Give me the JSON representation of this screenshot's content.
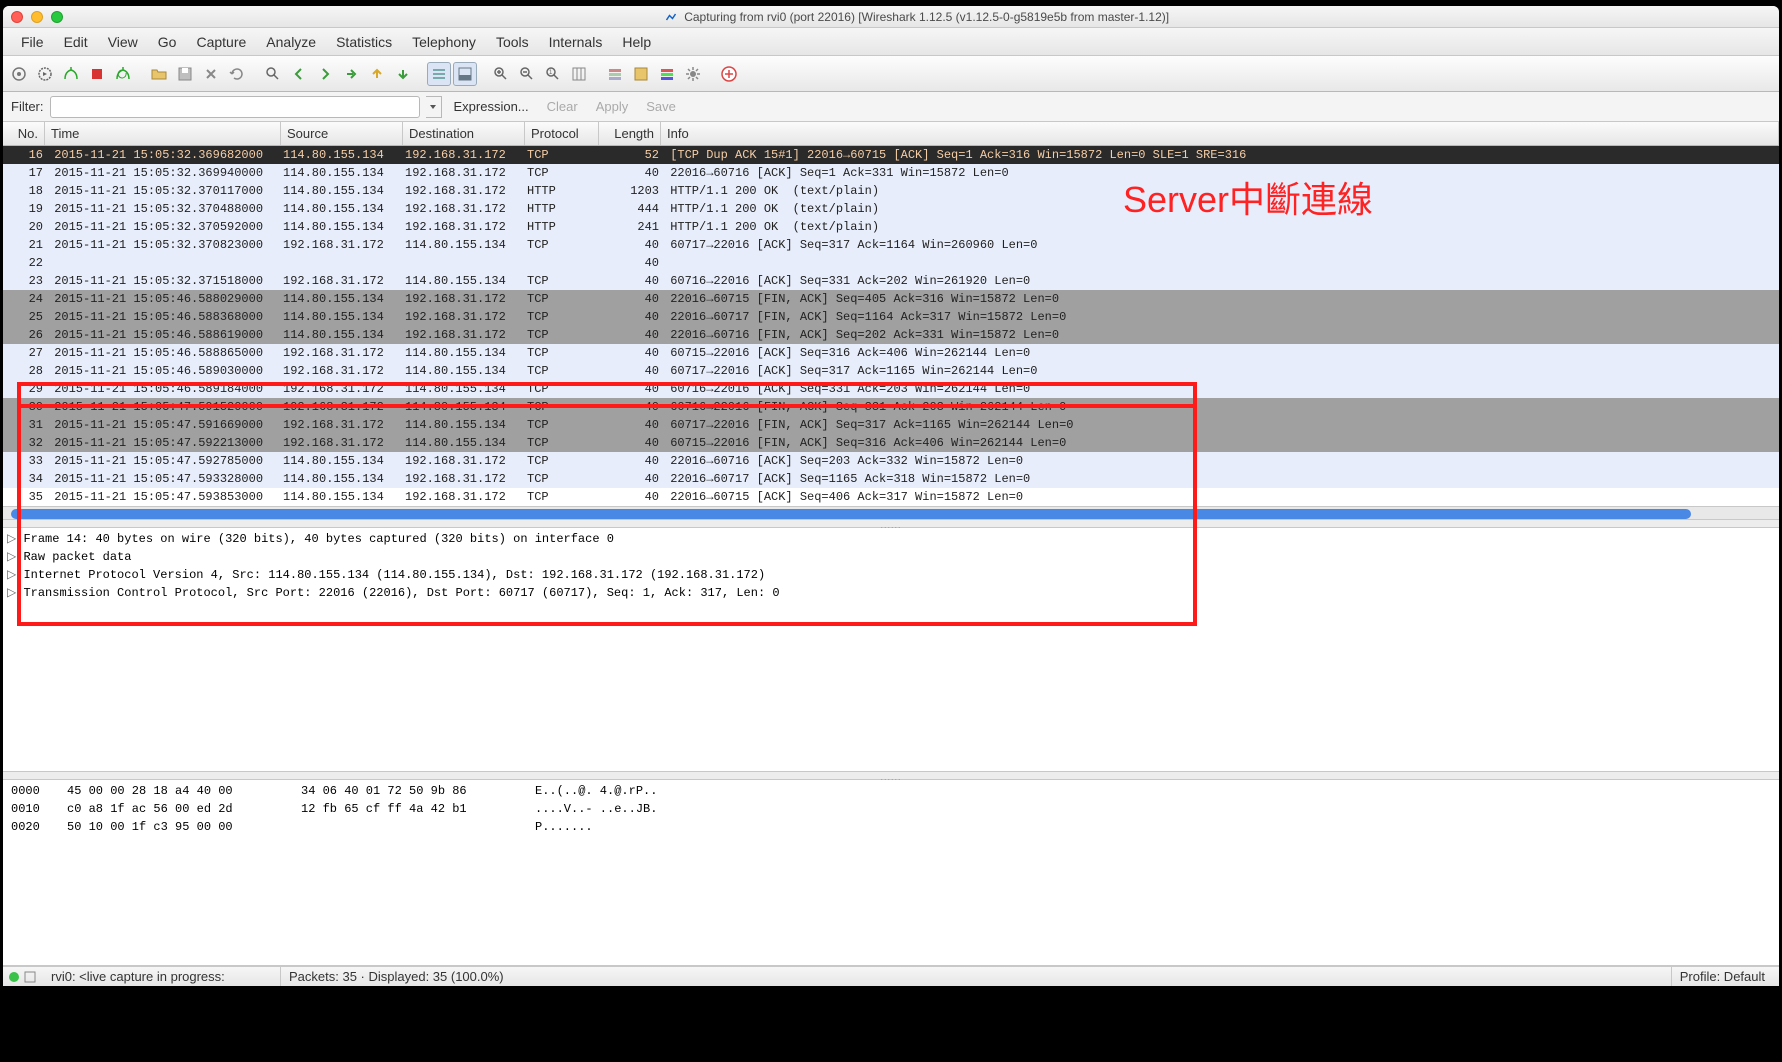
{
  "title": "Capturing from rvi0 (port 22016)   [Wireshark 1.12.5  (v1.12.5-0-g5819e5b from master-1.12)]",
  "menu": [
    "File",
    "Edit",
    "View",
    "Go",
    "Capture",
    "Analyze",
    "Statistics",
    "Telephony",
    "Tools",
    "Internals",
    "Help"
  ],
  "filter": {
    "label": "Filter:",
    "value": "",
    "expression": "Expression...",
    "clear": "Clear",
    "apply": "Apply",
    "save": "Save"
  },
  "columns": [
    "No.",
    "Time",
    "Source",
    "Destination",
    "Protocol",
    "Length",
    "Info"
  ],
  "packets": [
    {
      "no": 16,
      "time": "2015-11-21 15:05:32.369682000",
      "src": "114.80.155.134",
      "dst": "192.168.31.172",
      "proto": "TCP",
      "len": 52,
      "info": "[TCP Dup ACK 15#1] 22016→60715 [ACK] Seq=1 Ack=316 Win=15872 Len=0 SLE=1 SRE=316",
      "bg": "dark"
    },
    {
      "no": 17,
      "time": "2015-11-21 15:05:32.369940000",
      "src": "114.80.155.134",
      "dst": "192.168.31.172",
      "proto": "TCP",
      "len": 40,
      "info": "22016→60716 [ACK] Seq=1 Ack=331 Win=15872 Len=0",
      "bg": "light"
    },
    {
      "no": 18,
      "time": "2015-11-21 15:05:32.370117000",
      "src": "114.80.155.134",
      "dst": "192.168.31.172",
      "proto": "HTTP",
      "len": 1203,
      "info": "HTTP/1.1 200 OK  (text/plain)",
      "bg": "light"
    },
    {
      "no": 19,
      "time": "2015-11-21 15:05:32.370488000",
      "src": "114.80.155.134",
      "dst": "192.168.31.172",
      "proto": "HTTP",
      "len": 444,
      "info": "HTTP/1.1 200 OK  (text/plain)",
      "bg": "light"
    },
    {
      "no": 20,
      "time": "2015-11-21 15:05:32.370592000",
      "src": "114.80.155.134",
      "dst": "192.168.31.172",
      "proto": "HTTP",
      "len": 241,
      "info": "HTTP/1.1 200 OK  (text/plain)",
      "bg": "light"
    },
    {
      "no": 21,
      "time": "2015-11-21 15:05:32.370823000",
      "src": "192.168.31.172",
      "dst": "114.80.155.134",
      "proto": "TCP",
      "len": 40,
      "info": "60717→22016 [ACK] Seq=317 Ack=1164 Win=260960 Len=0",
      "bg": "light"
    },
    {
      "no": 22,
      "time": "",
      "src": "",
      "dst": "",
      "proto": "",
      "len": 40,
      "info": "",
      "bg": "light"
    },
    {
      "no": 23,
      "time": "2015-11-21 15:05:32.371518000",
      "src": "192.168.31.172",
      "dst": "114.80.155.134",
      "proto": "TCP",
      "len": 40,
      "info": "60716→22016 [ACK] Seq=331 Ack=202 Win=261920 Len=0",
      "bg": "light"
    },
    {
      "no": 24,
      "time": "2015-11-21 15:05:46.588029000",
      "src": "114.80.155.134",
      "dst": "192.168.31.172",
      "proto": "TCP",
      "len": 40,
      "info": "22016→60715 [FIN, ACK] Seq=405 Ack=316 Win=15872 Len=0",
      "bg": "gray"
    },
    {
      "no": 25,
      "time": "2015-11-21 15:05:46.588368000",
      "src": "114.80.155.134",
      "dst": "192.168.31.172",
      "proto": "TCP",
      "len": 40,
      "info": "22016→60717 [FIN, ACK] Seq=1164 Ack=317 Win=15872 Len=0",
      "bg": "gray"
    },
    {
      "no": 26,
      "time": "2015-11-21 15:05:46.588619000",
      "src": "114.80.155.134",
      "dst": "192.168.31.172",
      "proto": "TCP",
      "len": 40,
      "info": "22016→60716 [FIN, ACK] Seq=202 Ack=331 Win=15872 Len=0",
      "bg": "gray"
    },
    {
      "no": 27,
      "time": "2015-11-21 15:05:46.588865000",
      "src": "192.168.31.172",
      "dst": "114.80.155.134",
      "proto": "TCP",
      "len": 40,
      "info": "60715→22016 [ACK] Seq=316 Ack=406 Win=262144 Len=0",
      "bg": "light"
    },
    {
      "no": 28,
      "time": "2015-11-21 15:05:46.589030000",
      "src": "192.168.31.172",
      "dst": "114.80.155.134",
      "proto": "TCP",
      "len": 40,
      "info": "60717→22016 [ACK] Seq=317 Ack=1165 Win=262144 Len=0",
      "bg": "light"
    },
    {
      "no": 29,
      "time": "2015-11-21 15:05:46.589184000",
      "src": "192.168.31.172",
      "dst": "114.80.155.134",
      "proto": "TCP",
      "len": 40,
      "info": "60716→22016 [ACK] Seq=331 Ack=203 Win=262144 Len=0",
      "bg": "light"
    },
    {
      "no": 30,
      "time": "2015-11-21 15:05:47.591520000",
      "src": "192.168.31.172",
      "dst": "114.80.155.134",
      "proto": "TCP",
      "len": 40,
      "info": "60716→22016 [FIN, ACK] Seq=331 Ack=203 Win=262144 Len=0",
      "bg": "gray"
    },
    {
      "no": 31,
      "time": "2015-11-21 15:05:47.591669000",
      "src": "192.168.31.172",
      "dst": "114.80.155.134",
      "proto": "TCP",
      "len": 40,
      "info": "60717→22016 [FIN, ACK] Seq=317 Ack=1165 Win=262144 Len=0",
      "bg": "gray"
    },
    {
      "no": 32,
      "time": "2015-11-21 15:05:47.592213000",
      "src": "192.168.31.172",
      "dst": "114.80.155.134",
      "proto": "TCP",
      "len": 40,
      "info": "60715→22016 [FIN, ACK] Seq=316 Ack=406 Win=262144 Len=0",
      "bg": "gray"
    },
    {
      "no": 33,
      "time": "2015-11-21 15:05:47.592785000",
      "src": "114.80.155.134",
      "dst": "192.168.31.172",
      "proto": "TCP",
      "len": 40,
      "info": "22016→60716 [ACK] Seq=203 Ack=332 Win=15872 Len=0",
      "bg": "light"
    },
    {
      "no": 34,
      "time": "2015-11-21 15:05:47.593328000",
      "src": "114.80.155.134",
      "dst": "192.168.31.172",
      "proto": "TCP",
      "len": 40,
      "info": "22016→60717 [ACK] Seq=1165 Ack=318 Win=15872 Len=0",
      "bg": "light"
    },
    {
      "no": 35,
      "time": "2015-11-21 15:05:47.593853000",
      "src": "114.80.155.134",
      "dst": "192.168.31.172",
      "proto": "TCP",
      "len": 40,
      "info": "22016→60715 [ACK] Seq=406 Ack=317 Win=15872 Len=0",
      "bg": "white"
    }
  ],
  "details": [
    "Frame 14: 40 bytes on wire (320 bits), 40 bytes captured (320 bits) on interface 0",
    "Raw packet data",
    "Internet Protocol Version 4, Src: 114.80.155.134 (114.80.155.134), Dst: 192.168.31.172 (192.168.31.172)",
    "Transmission Control Protocol, Src Port: 22016 (22016), Dst Port: 60717 (60717), Seq: 1, Ack: 317, Len: 0"
  ],
  "hex": [
    {
      "off": "0000",
      "b1": "45 00 00 28 18 a4 40 00",
      "b2": "34 06 40 01 72 50 9b 86",
      "asc": "E..(..@. 4.@.rP.."
    },
    {
      "off": "0010",
      "b1": "c0 a8 1f ac 56 00 ed 2d",
      "b2": "12 fb 65 cf ff 4a 42 b1",
      "asc": "....V..- ..e..JB."
    },
    {
      "off": "0020",
      "b1": "50 10 00 1f c3 95 00 00",
      "b2": "",
      "asc": "P......."
    }
  ],
  "status": {
    "capture": "rvi0: <live capture in progress:",
    "packets": "Packets: 35 · Displayed: 35 (100.0%)",
    "profile": "Profile: Default"
  },
  "annotation": "Server中斷連線"
}
